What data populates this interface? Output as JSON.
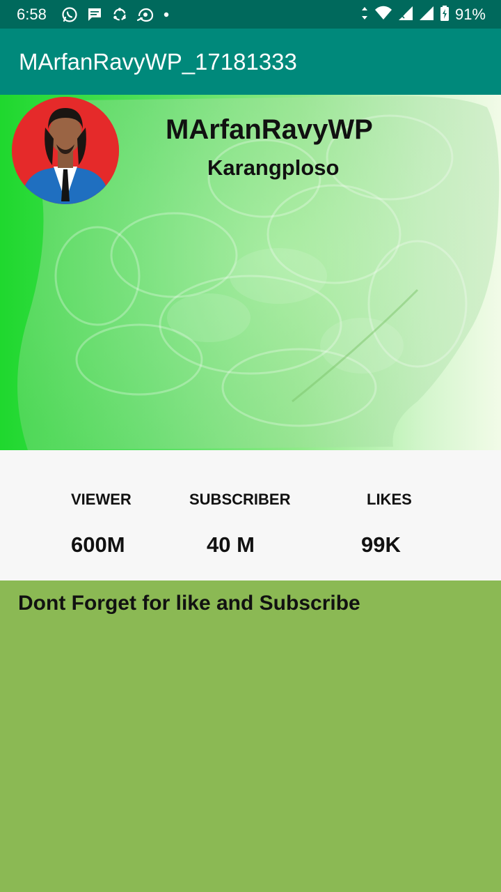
{
  "status_bar": {
    "time": "6:58",
    "battery": "91%",
    "left_icons": [
      "whatsapp-icon",
      "message-icon",
      "sync-icon",
      "browser-icon",
      "dot-icon"
    ],
    "right_icons": [
      "data-arrows-icon",
      "wifi-icon",
      "signal-icon",
      "signal-icon",
      "battery-charging-icon"
    ]
  },
  "app_bar": {
    "title": "MArfanRavyWP_17181333"
  },
  "profile": {
    "name": "MArfanRavyWP",
    "location": "Karangploso",
    "avatar_bg": "#e52a2a"
  },
  "stats": {
    "viewer": {
      "label": "VIEWER",
      "value": "600M"
    },
    "subscriber": {
      "label": "SUBSCRIBER",
      "value": "40 M"
    },
    "likes": {
      "label": "LIKES",
      "value": "99K"
    }
  },
  "footer": {
    "message": "Dont Forget for like and Subscribe"
  },
  "colors": {
    "status_bar": "#00695c",
    "app_bar": "#00897b",
    "header_gradient_start": "#1fd82e",
    "stats_bg": "#f7f7f7",
    "page_bg": "#8bb954"
  }
}
